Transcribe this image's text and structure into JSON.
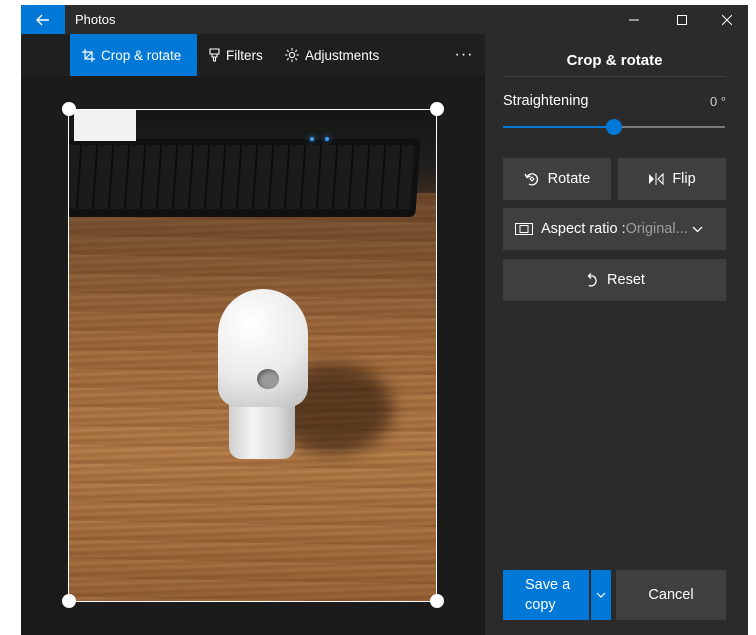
{
  "titlebar": {
    "app_title": "Photos",
    "back_icon": "arrow-left-icon",
    "minimize_icon": "minimize-icon",
    "maximize_icon": "maximize-icon",
    "close_icon": "close-icon"
  },
  "toolbar": {
    "tools": [
      {
        "label": "Crop & rotate",
        "icon": "crop-icon",
        "active": true
      },
      {
        "label": "Filters",
        "icon": "filter-icon",
        "active": false
      },
      {
        "label": "Adjustments",
        "icon": "brightness-icon",
        "active": false
      }
    ],
    "more_label": "···"
  },
  "panel": {
    "title": "Crop & rotate",
    "straightening": {
      "label": "Straightening",
      "value": "0 °",
      "slider_fraction": 0.5
    },
    "rotate_label": "Rotate",
    "flip_label": "Flip",
    "aspect_label": "Aspect ratio : ",
    "aspect_value": "Original...",
    "reset_label": "Reset",
    "save_label_line1": "Save a",
    "save_label_line2": "copy",
    "cancel_label": "Cancel"
  },
  "colors": {
    "accent": "#0078d7",
    "window_bg": "#1f1f1f",
    "panel_bg": "#2b2b2b",
    "button_bg": "#3f3f3f"
  }
}
